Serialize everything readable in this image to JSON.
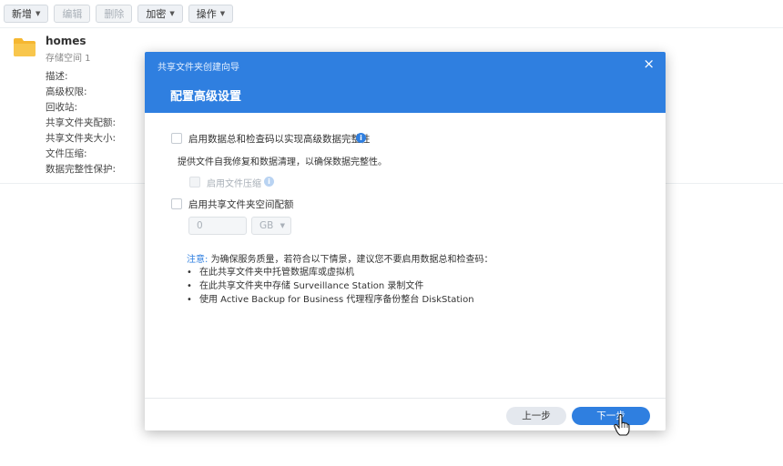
{
  "toolbar": {
    "create_label": "新增",
    "edit_label": "编辑",
    "delete_label": "删除",
    "encrypt_label": "加密",
    "action_label": "操作"
  },
  "share": {
    "name": "homes",
    "storage": "存储空间 1",
    "properties": [
      "描述:",
      "高级权限:",
      "回收站:",
      "共享文件夹配额:",
      "共享文件夹大小:",
      "文件压缩:",
      "数据完整性保护:"
    ]
  },
  "dialog": {
    "title": "共享文件夹创建向导",
    "subtitle": "配置高级设置",
    "checksum_label": "启用数据总和检查码以实现高级数据完整性",
    "checksum_desc": "提供文件自我修复和数据清理，以确保数据完整性。",
    "compression_label": "启用文件压缩",
    "quota_label": "启用共享文件夹空间配额",
    "quota_value": "0",
    "quota_unit": "GB",
    "note_label": "注意:",
    "note_text": "为确保服务质量，若符合以下情景，建议您不要启用数据总和检查码：",
    "bullets": [
      "在此共享文件夹中托管数据库或虚拟机",
      "在此共享文件夹中存储 Surveillance Station 录制文件",
      "使用 Active Backup for Business 代理程序备份整台 DiskStation"
    ],
    "prev_label": "上一步",
    "next_label": "下一步"
  },
  "colors": {
    "accent": "#2f7fe0",
    "folder": "#f5b731"
  },
  "icons": {
    "info": "info-icon",
    "close": "close-icon",
    "folder": "folder-icon",
    "cursor": "hand-pointer-icon"
  }
}
